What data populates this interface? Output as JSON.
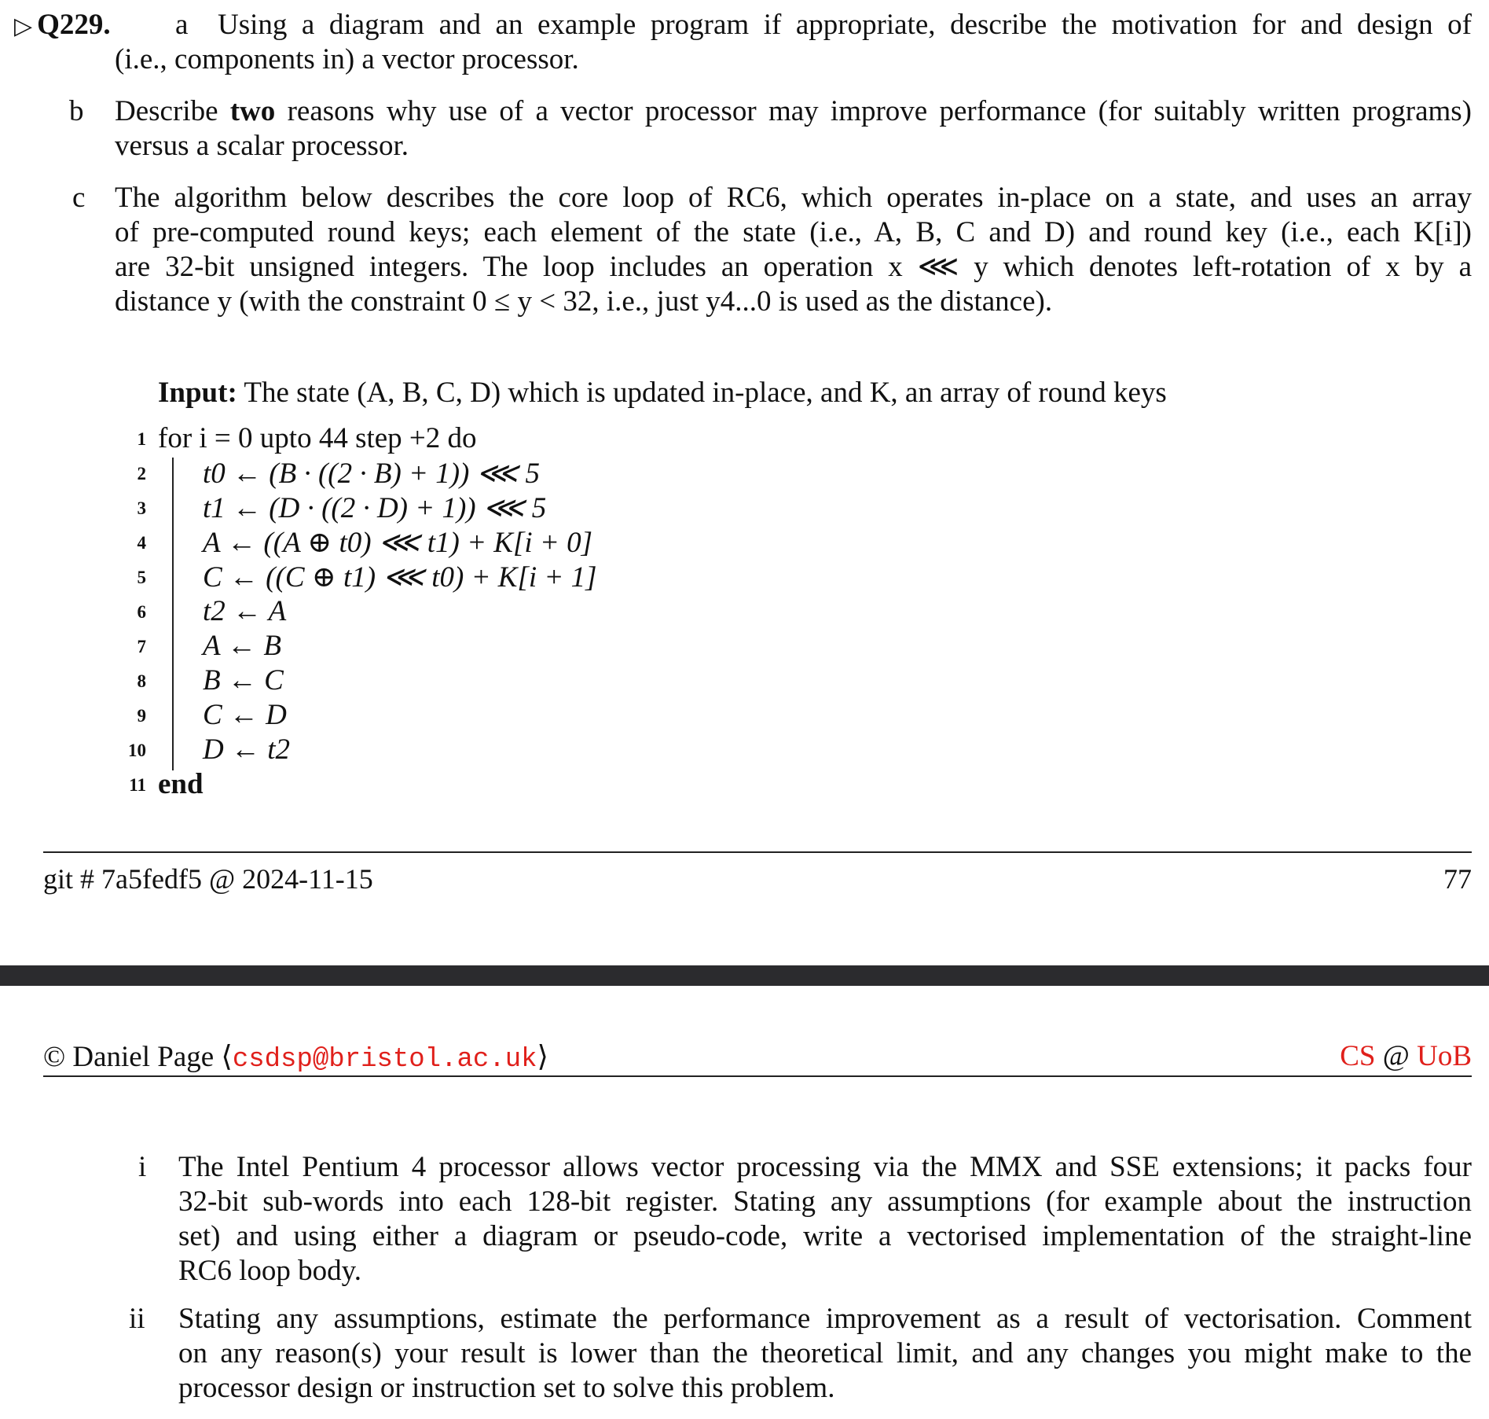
{
  "question": {
    "marker": "▷",
    "number": "Q229.",
    "part_a": {
      "label": "a",
      "line1": "Using a diagram and an example program if appropriate, describe the motivation for and design of",
      "line2": "(i.e., components in) a vector processor."
    },
    "part_b": {
      "label": "b",
      "line1_pre": "Describe ",
      "line1_bold": "two",
      "line1_post": " reasons why use of a vector processor may improve performance (for suitably written programs)",
      "line2": "versus a scalar processor."
    },
    "part_c": {
      "label": "c",
      "line1": "The algorithm below describes the core loop of RC6, which operates in-place on a state, and uses an array",
      "line2": "of pre-computed round keys; each element of the state (i.e., A, B, C and D) and round key (i.e., each K[i])",
      "line3": "are 32-bit unsigned integers. The loop includes an operation x ⋘ y which denotes left-rotation of x by a",
      "line4": "distance y (with the constraint 0 ≤ y < 32, i.e., just y4...0 is used as the distance)."
    }
  },
  "algorithm": {
    "input_label": "Input:",
    "input_text": "The state (A, B, C, D) which is updated in-place, and K, an array of round keys",
    "lines": [
      {
        "num": "1",
        "text": "for i = 0 upto 44 step +2 do"
      },
      {
        "num": "2",
        "text": "t0 ← (B · ((2 · B) + 1)) ⋘ 5"
      },
      {
        "num": "3",
        "text": "t1 ← (D · ((2 · D) + 1)) ⋘ 5"
      },
      {
        "num": "4",
        "text": "A ← ((A ⊕ t0) ⋘ t1) + K[i + 0]"
      },
      {
        "num": "5",
        "text": "C ← ((C ⊕ t1) ⋘ t0) + K[i + 1]"
      },
      {
        "num": "6",
        "text": "t2 ← A"
      },
      {
        "num": "7",
        "text": "A ← B"
      },
      {
        "num": "8",
        "text": "B ← C"
      },
      {
        "num": "9",
        "text": "C ← D"
      },
      {
        "num": "10",
        "text": "D ← t2"
      },
      {
        "num": "11",
        "text": "end"
      }
    ]
  },
  "footer": {
    "git": "git # 7a5fedf5 @ 2024-11-15",
    "page": "77"
  },
  "header": {
    "copyright": "© Daniel Page ⟨",
    "email": "csdsp@bristol.ac.uk",
    "copyright_close": "⟩",
    "org_cs": "CS",
    "org_at": " @ ",
    "org_uob": "UoB"
  },
  "subparts": {
    "i": {
      "label": "i",
      "line1": "The Intel Pentium 4 processor allows vector processing via the MMX and SSE extensions; it packs four",
      "line2": "32-bit sub-words into each 128-bit register. Stating any assumptions (for example about the instruction",
      "line3": "set) and using either a diagram or pseudo-code, write a vectorised implementation of the straight-line",
      "line4": "RC6 loop body."
    },
    "ii": {
      "label": "ii",
      "line1": "Stating any assumptions, estimate the performance improvement as a result of vectorisation. Comment",
      "line2": "on any reason(s) your result is lower than the theoretical limit, and any changes you might make to the",
      "line3": "processor design or instruction set to solve this problem."
    }
  },
  "colors": {
    "accent_red": "#e0201b",
    "divider": "#2b2b2e"
  }
}
